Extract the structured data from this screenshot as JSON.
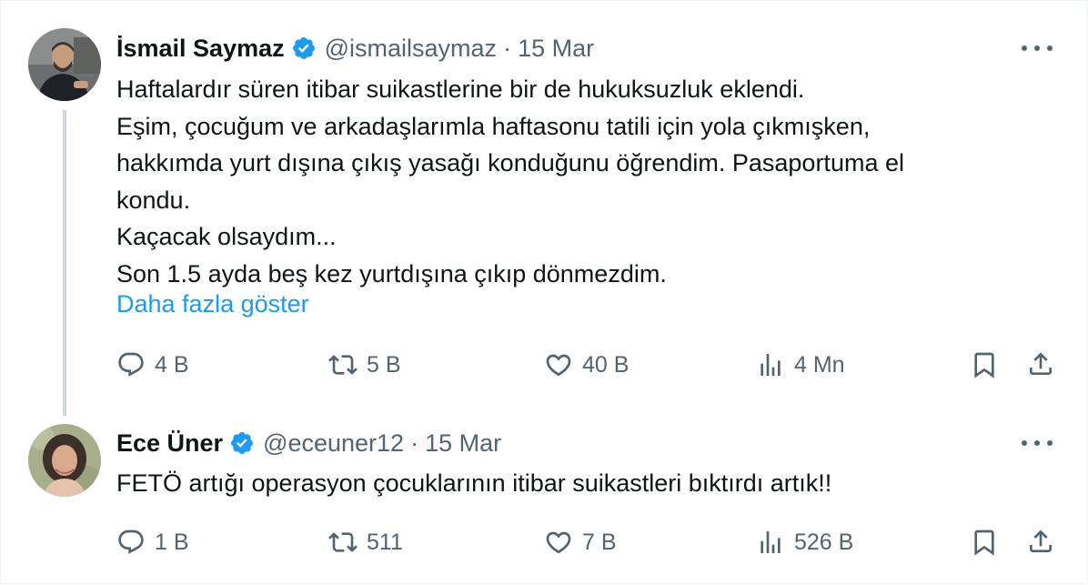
{
  "tweets": [
    {
      "name": "İsmail Saymaz",
      "handle": "@ismailsaymaz",
      "separator": "·",
      "date": "15 Mar",
      "verified": true,
      "text_lines": [
        "Haftalardır süren itibar suikastlerine bir de hukuksuzluk eklendi.",
        "Eşim, çocuğum ve arkadaşlarımla haftasonu tatili için yola çıkmışken,",
        "hakkımda yurt dışına çıkış yasağı konduğunu öğrendim. Pasaportuma el",
        "kondu.",
        "Kaçacak olsaydım...",
        "Son 1.5 ayda beş kez yurtdışına çıkıp dönmezdim."
      ],
      "show_more": "Daha fazla göster",
      "stats": {
        "replies": "4 B",
        "reposts": "5 B",
        "likes": "40 B",
        "views": "4 Mn"
      }
    },
    {
      "name": "Ece Üner",
      "handle": "@eceuner12",
      "separator": "·",
      "date": "15 Mar",
      "verified": true,
      "text_lines": [
        "FETÖ artığı operasyon çocuklarının itibar suikastleri bıktırdı artık!!"
      ],
      "stats": {
        "replies": "1 B",
        "reposts": "511",
        "likes": "7 B",
        "views": "526 B"
      }
    }
  ],
  "colors": {
    "accent": "#1d9bf0",
    "text": "#0f1419",
    "muted": "#536471",
    "thread_line": "#cfd9de"
  },
  "icons": [
    "verified-badge-icon",
    "more-icon",
    "reply-icon",
    "repost-icon",
    "like-icon",
    "views-icon",
    "bookmark-icon",
    "share-icon"
  ]
}
